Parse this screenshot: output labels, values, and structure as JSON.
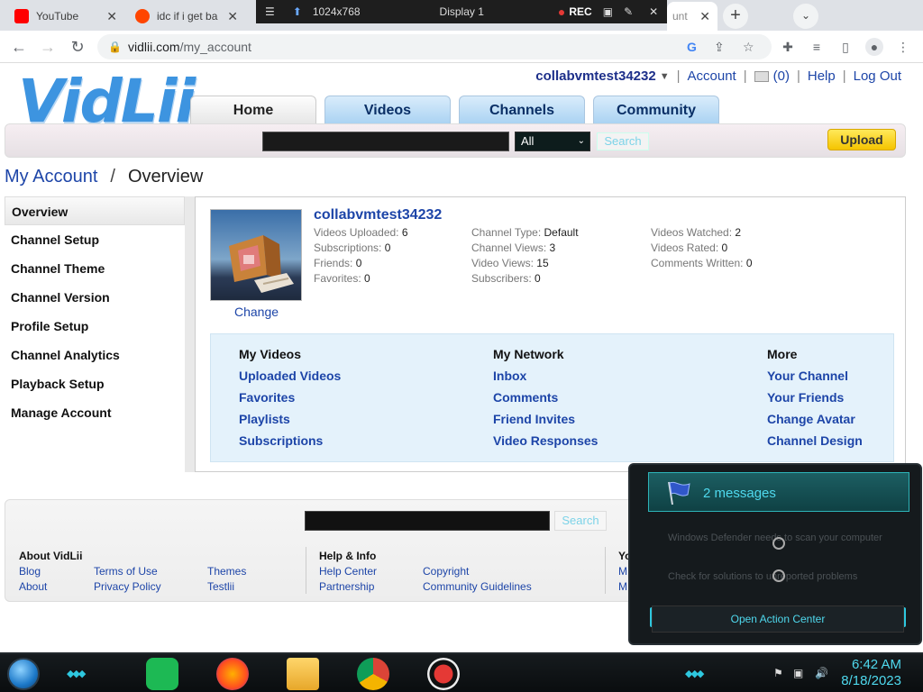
{
  "browser": {
    "tabs": [
      {
        "title": "YouTube"
      },
      {
        "title": "idc if i get ba"
      },
      {
        "title": "unt"
      }
    ],
    "overlay": {
      "resolution": "1024x768",
      "display": "Display 1",
      "rec": "REC"
    },
    "url_host": "vidlii.com",
    "url_path": "/my_account"
  },
  "site": {
    "logo": "VidLii",
    "username": "collabvmtest34232",
    "account": "Account",
    "inbox_count": "(0)",
    "help": "Help",
    "logout": "Log Out",
    "tabs": [
      "Home",
      "Videos",
      "Channels",
      "Community"
    ],
    "search_scope": "All",
    "search_button": "Search",
    "upload": "Upload"
  },
  "breadcrumb": {
    "parent": "My Account",
    "sep": "/",
    "current": "Overview"
  },
  "sidebar": {
    "items": [
      {
        "label": "Overview"
      },
      {
        "label": "Channel Setup"
      },
      {
        "label": "Channel Theme"
      },
      {
        "label": "Channel Version"
      },
      {
        "label": "Profile Setup"
      },
      {
        "label": "Channel Analytics"
      },
      {
        "label": "Playback Setup"
      },
      {
        "label": "Manage Account"
      }
    ]
  },
  "profile": {
    "name": "collabvmtest34232",
    "change": "Change",
    "col1": [
      {
        "k": "Videos Uploaded:",
        "v": "6"
      },
      {
        "k": "Subscriptions:",
        "v": "0"
      },
      {
        "k": "Friends:",
        "v": "0"
      },
      {
        "k": "Favorites:",
        "v": "0"
      }
    ],
    "col2": [
      {
        "k": "Channel Type:",
        "v": "Default"
      },
      {
        "k": "Channel Views:",
        "v": "3"
      },
      {
        "k": "Video Views:",
        "v": "15"
      },
      {
        "k": "Subscribers:",
        "v": "0"
      }
    ],
    "col3": [
      {
        "k": "Videos Watched:",
        "v": "2"
      },
      {
        "k": "Videos Rated:",
        "v": "0"
      },
      {
        "k": "Comments Written:",
        "v": "0"
      }
    ]
  },
  "links": {
    "my_videos": {
      "title": "My Videos",
      "items": [
        "Uploaded Videos",
        "Favorites",
        "Playlists",
        "Subscriptions"
      ]
    },
    "my_network": {
      "title": "My Network",
      "items": [
        "Inbox",
        "Comments",
        "Friend Invites",
        "Video Responses"
      ]
    },
    "more": {
      "title": "More",
      "items": [
        "Your Channel",
        "Your Friends",
        "Change Avatar",
        "Channel Design"
      ]
    }
  },
  "footer": {
    "search_button": "Search",
    "about": {
      "title": "About VidLii",
      "a": [
        "Blog",
        "About"
      ],
      "b": [
        "Terms of Use",
        "Privacy Policy"
      ],
      "c": [
        "Themes",
        "Testlii"
      ]
    },
    "help": {
      "title": "Help & Info",
      "a": [
        "Help Center",
        "Partnership"
      ],
      "b": [
        "Copyright",
        "Community Guidelines"
      ]
    },
    "third": {
      "title": "Yo",
      "a": [
        "M",
        "M"
      ]
    }
  },
  "notification": {
    "title": "2 messages",
    "messages": [
      "Windows Defender needs to scan your computer",
      "Check for solutions to unreported problems"
    ],
    "action": "Open Action Center"
  },
  "taskbar": {
    "time": "6:42 AM",
    "date": "8/18/2023"
  },
  "colors": {
    "link": "#1d45a8",
    "accent": "#2ec8df",
    "upload": "#f5c400"
  }
}
